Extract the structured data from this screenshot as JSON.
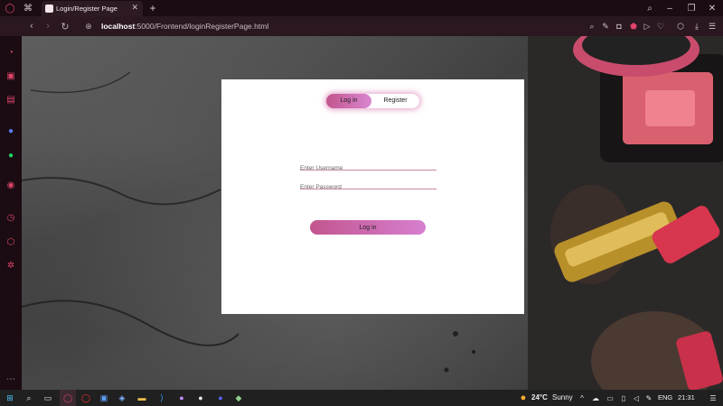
{
  "browser": {
    "tab": {
      "title": "Login/Register Page"
    },
    "address": {
      "host": "localhost",
      "path": ":5000/Frontend/loginRegisterPage.html"
    }
  },
  "sidebar": {
    "items": [
      {
        "name": "speed-dial-icon",
        "glyph": "◔"
      },
      {
        "name": "store-icon",
        "glyph": "▣"
      },
      {
        "name": "twitch-icon",
        "glyph": "▤"
      },
      {
        "name": "messenger-icon",
        "glyph": "●"
      },
      {
        "name": "whatsapp-icon",
        "glyph": "●"
      },
      {
        "name": "player-icon",
        "glyph": "◉"
      },
      {
        "name": "history-icon",
        "glyph": "◷"
      },
      {
        "name": "extensions-icon",
        "glyph": "⬡"
      },
      {
        "name": "settings-icon",
        "glyph": "✲"
      }
    ]
  },
  "auth": {
    "tabs": {
      "login": "Log in",
      "register": "Register"
    },
    "username": {
      "placeholder": "Enter Username"
    },
    "password": {
      "placeholder": "Enter Password"
    },
    "submit": "Log in"
  },
  "taskbar": {
    "weather": {
      "temp": "24°C",
      "condition": "Sunny"
    },
    "language": "ENG",
    "time": "21:31"
  },
  "colors": {
    "accent_start": "#c2558e",
    "accent_end": "#d77fd0",
    "opera_red": "#e0446a"
  }
}
